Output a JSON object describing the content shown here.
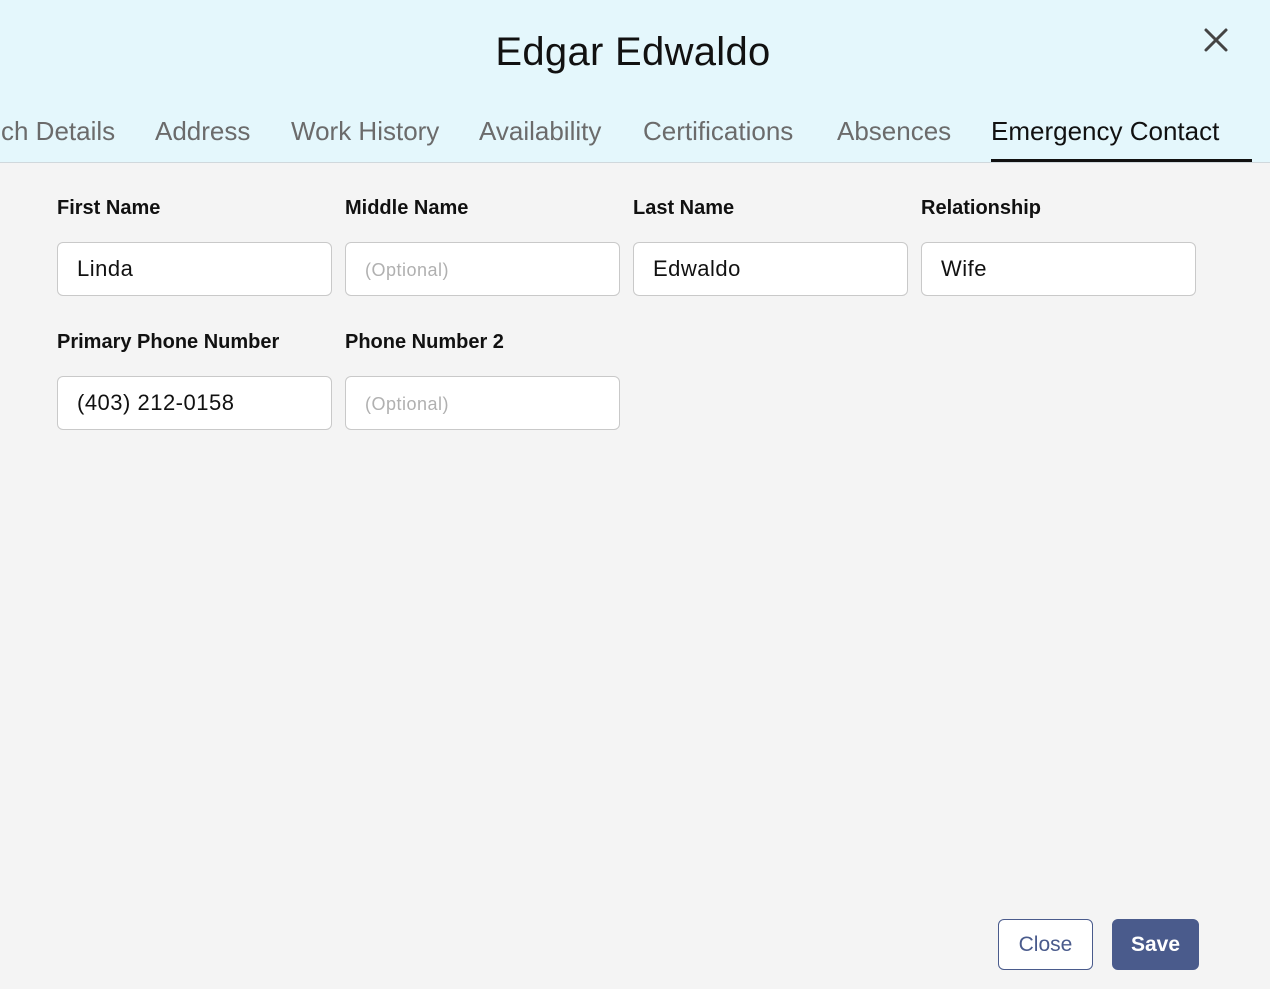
{
  "dialog": {
    "title": "Edgar Edwaldo",
    "close_icon": "close-icon"
  },
  "tabs": [
    {
      "label": "ch Details"
    },
    {
      "label": "Address"
    },
    {
      "label": "Work History"
    },
    {
      "label": "Availability"
    },
    {
      "label": "Certifications"
    },
    {
      "label": "Absences"
    },
    {
      "label": "Emergency Contact",
      "active": true
    }
  ],
  "form": {
    "first_name": {
      "label": "First Name",
      "value": "Linda",
      "placeholder": ""
    },
    "middle_name": {
      "label": "Middle Name",
      "value": "",
      "placeholder": "(Optional)"
    },
    "last_name": {
      "label": "Last Name",
      "value": "Edwaldo",
      "placeholder": ""
    },
    "relationship": {
      "label": "Relationship",
      "value": "Wife",
      "placeholder": ""
    },
    "primary_phone": {
      "label": "Primary Phone Number",
      "value": "(403) 212-0158",
      "placeholder": ""
    },
    "phone_2": {
      "label": "Phone Number 2",
      "value": "",
      "placeholder": "(Optional)"
    }
  },
  "footer": {
    "close_label": "Close",
    "save_label": "Save"
  },
  "colors": {
    "header_bg": "#e4f7fc",
    "body_bg": "#f4f4f4",
    "accent": "#4a5b8c"
  }
}
